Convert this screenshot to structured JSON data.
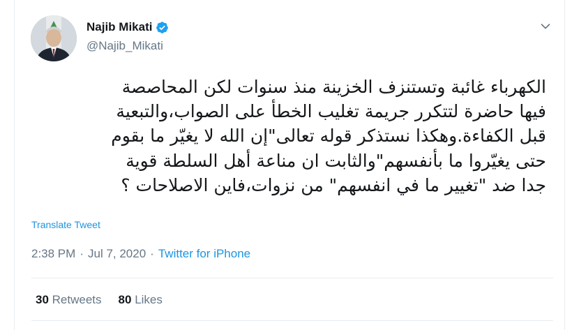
{
  "author": {
    "name": "Najib Mikati",
    "handle": "@Najib_Mikati",
    "verified": true
  },
  "tweet": {
    "lines": [
      "الكهرباء غائبة وتستنزف الخزينة منذ سنوات لكن المحاصصة",
      "فيها حاضرة لتتكرر جريمة تغليب الخطأ على الصواب،والتبعية",
      "قبل الكفاءة.وهكذا نستذكر قوله تعالى\"إن الله لا يغيّر ما بقوم",
      "حتى يغيّروا ما بأنفسهم\"والثابت ان مناعة أهل السلطة قوية",
      "جدا ضد \"تغيير ما في انفسهم\" من نزوات،فاين الاصلاحات ؟"
    ],
    "translate_label": "Translate Tweet",
    "time": "2:38 PM",
    "separator": "·",
    "date": "Jul 7, 2020",
    "source": "Twitter for iPhone"
  },
  "stats": {
    "retweets_count": "30",
    "retweets_label": "Retweets",
    "likes_count": "80",
    "likes_label": "Likes"
  },
  "colors": {
    "link": "#1b95e0",
    "text": "#14171a",
    "muted": "#657786",
    "border": "#e6ecf0",
    "verified": "#1da1f2"
  },
  "icons": {
    "verified": "verified-badge-icon",
    "caret": "chevron-down-icon"
  }
}
